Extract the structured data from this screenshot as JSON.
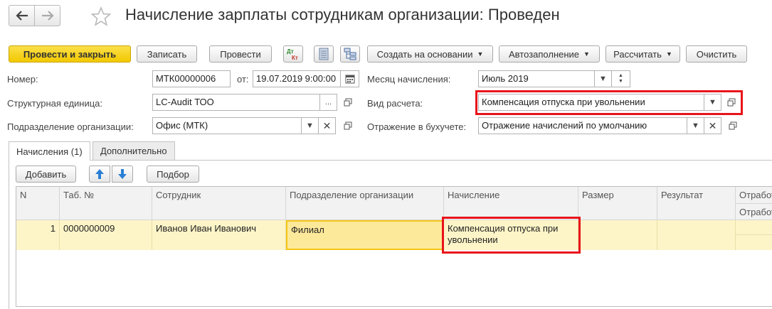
{
  "window": {
    "title": "Начисление зарплаты сотрудникам организации: Проведен"
  },
  "toolbar": {
    "post_close": "Провести и закрыть",
    "save": "Записать",
    "post": "Провести",
    "create_based": "Создать на основании",
    "autofill": "Автозаполнение",
    "calculate": "Рассчитать",
    "clear": "Очистить"
  },
  "form": {
    "number_label": "Номер:",
    "number_value": "МТК00000006",
    "date_label": "от:",
    "date_value": "19.07.2019  9:00:00",
    "month_label": "Месяц начисления:",
    "month_value": "Июль 2019",
    "unit_label": "Структурная единица:",
    "unit_value": "LC-Audit ТОО",
    "calc_type_label": "Вид расчета:",
    "calc_type_value": "Компенсация отпуска при увольнении",
    "division_label": "Подразделение организации:",
    "division_value": "Офис (МТК)",
    "accounting_label": "Отражение в бухучете:",
    "accounting_value": "Отражение начислений по умолчанию",
    "ellipsis": "..."
  },
  "tabs": [
    {
      "label": "Начисления (1)"
    },
    {
      "label": "Дополнительно"
    }
  ],
  "table_toolbar": {
    "add": "Добавить",
    "pick": "Подбор"
  },
  "table": {
    "headers": [
      "N",
      "Таб. №",
      "Сотрудник",
      "Подразделение организации",
      "Начисление",
      "Размер",
      "Результат",
      "Отработ",
      "Отработ"
    ],
    "rows": [
      {
        "n": "1",
        "tab_no": "0000000009",
        "employee": "Иванов Иван Иванович",
        "division": "Филиал",
        "accrual": "Компенсация отпуска при увольнении",
        "size": "",
        "result": ""
      }
    ]
  },
  "colors": {
    "primary_button": "#f2c800",
    "highlight_border": "#e8141a",
    "row_background": "#fdf5c8",
    "selected_cell": "#fde99a",
    "arrow_blue": "#2a7fd4"
  }
}
